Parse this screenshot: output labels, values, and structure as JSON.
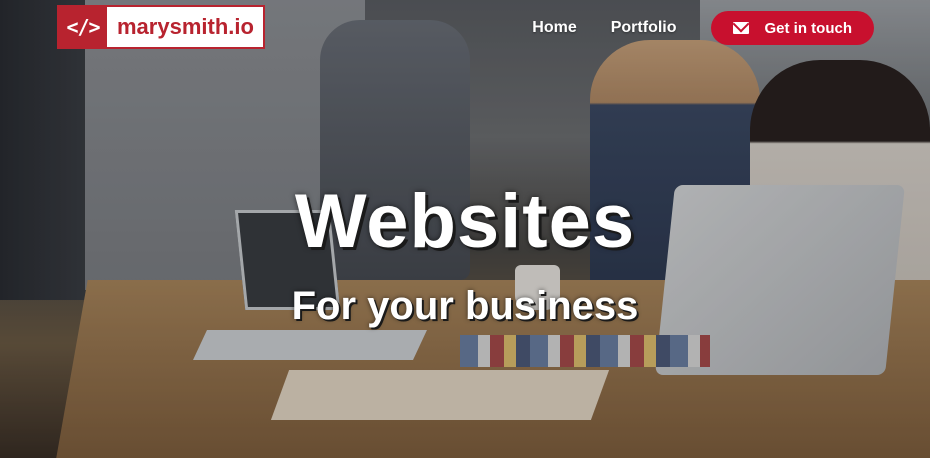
{
  "brand": {
    "logo_mark": "</>",
    "logo_text": "marysmith.io",
    "accent_color": "#c8102e"
  },
  "nav": {
    "items": [
      {
        "label": "Home"
      },
      {
        "label": "Portfolio"
      }
    ],
    "cta": {
      "label": "Get in touch",
      "icon": "envelope-icon"
    }
  },
  "hero": {
    "headline": "Websites",
    "subheadline": "For your business",
    "background": "office-meeting-photo"
  }
}
